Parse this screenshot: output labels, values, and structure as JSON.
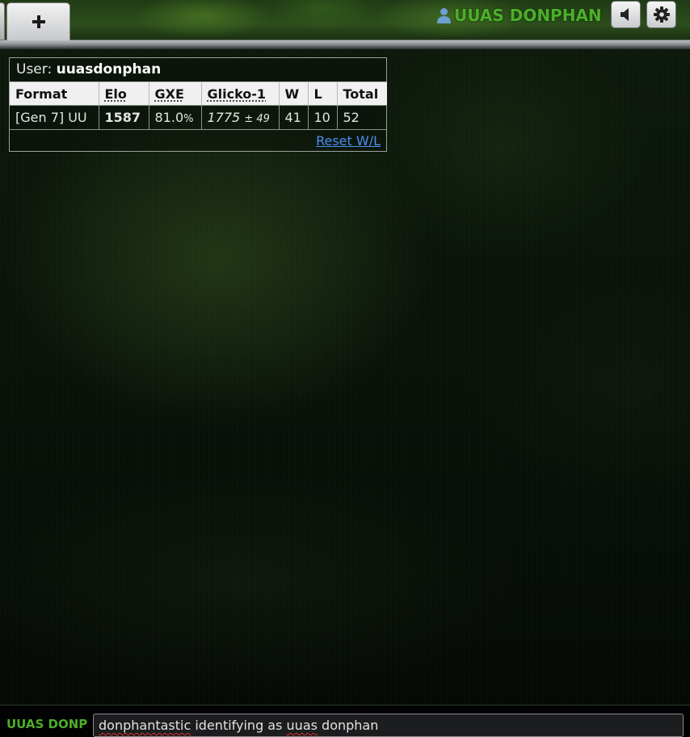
{
  "header": {
    "new_tab_icon": "plus-icon",
    "username": "UUAS DONPHAN",
    "user_icon": "user-icon",
    "sound_icon": "speaker-icon",
    "settings_icon": "gear-icon"
  },
  "stats": {
    "user_label": "User:",
    "user_name": "uuasdonphan",
    "columns": [
      "Format",
      "Elo",
      "GXE",
      "Glicko-1",
      "W",
      "L",
      "Total"
    ],
    "rows": [
      {
        "format": "[Gen 7] UU",
        "elo": "1587",
        "gxe_value": "81.0",
        "gxe_unit": "%",
        "glicko_rating": "1775",
        "glicko_dev": "± 49",
        "wins": "41",
        "losses": "10",
        "total": "52"
      }
    ],
    "reset_label": "Reset W/L"
  },
  "chat": {
    "username": "UUAS DONPHAN",
    "message_parts": [
      "donphantastic",
      " identifying as ",
      "uuas",
      " ",
      "donphan"
    ]
  },
  "colors": {
    "username_green": "#4caf2a",
    "link_blue": "#4d8df2"
  }
}
